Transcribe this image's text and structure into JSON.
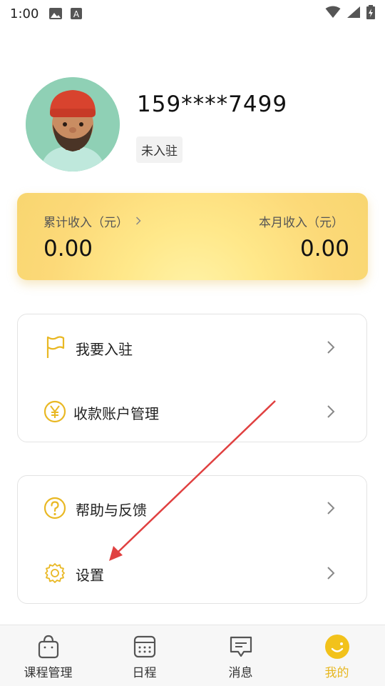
{
  "status_bar": {
    "time": "1:00",
    "icons": [
      "image-icon",
      "keyboard-a-icon",
      "wifi-icon",
      "signal-icon",
      "battery-charging-icon"
    ]
  },
  "profile": {
    "phone": "159****7499",
    "badge": "未入驻"
  },
  "earnings": {
    "total_label": "累计收入（元）",
    "total_value": "0.00",
    "month_label": "本月收入（元）",
    "month_value": "0.00"
  },
  "menu_group_1": [
    {
      "label": "我要入驻",
      "icon": "flag-icon"
    },
    {
      "label": "收款账户管理",
      "icon": "yen-icon"
    }
  ],
  "menu_group_2": [
    {
      "label": "帮助与反馈",
      "icon": "help-icon"
    },
    {
      "label": "设置",
      "icon": "gear-icon"
    }
  ],
  "tabbar": [
    {
      "label": "课程管理",
      "icon": "bag-icon"
    },
    {
      "label": "日程",
      "icon": "calendar-icon"
    },
    {
      "label": "消息",
      "icon": "message-icon"
    },
    {
      "label": "我的",
      "icon": "smiley-icon",
      "active": true
    }
  ],
  "colors": {
    "accent": "#e7b720",
    "icon_yellow": "#e9b824",
    "annotation": "#e04040"
  }
}
